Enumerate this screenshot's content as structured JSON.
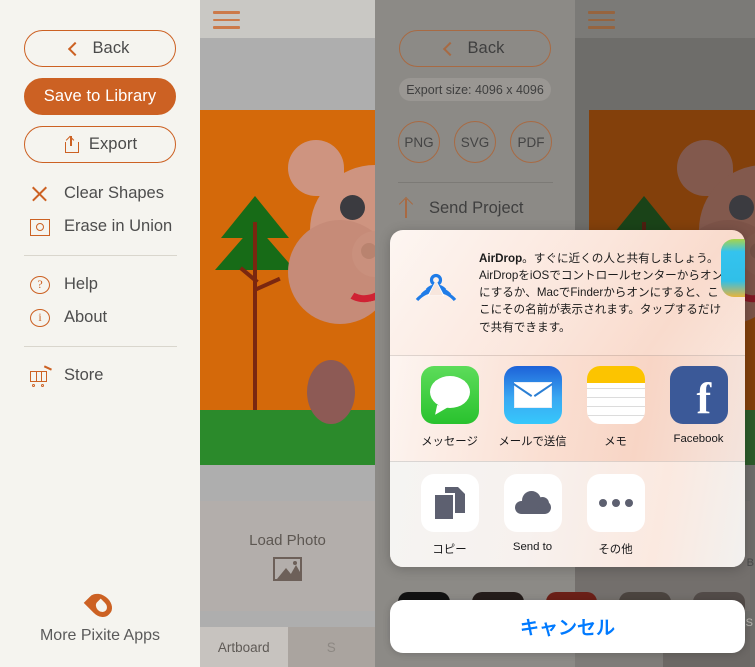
{
  "menu": {
    "back_label": "Back",
    "save_label": "Save to Library",
    "export_label": "Export",
    "items": [
      {
        "label": "Clear Shapes",
        "icon": "x-icon"
      },
      {
        "label": "Erase in Union",
        "icon": "square-circle-icon"
      },
      {
        "label": "Help",
        "icon": "question-circle-icon"
      },
      {
        "label": "About",
        "icon": "info-circle-icon"
      },
      {
        "label": "Store",
        "icon": "cart-icon"
      }
    ],
    "footer_label": "More Pixite Apps"
  },
  "artboard": {
    "load_photo_label": "Load Photo",
    "tab_artboard": "Artboard",
    "tab_second": "S"
  },
  "export": {
    "back_label": "Back",
    "size_chip": "Export size: 4096 x 4096",
    "formats": [
      "PNG",
      "SVG",
      "PDF"
    ],
    "send_project_label": "Send Project"
  },
  "share_sheet": {
    "airdrop_title": "AirDrop",
    "airdrop_text": "。すぐに近くの人と共有しましょう。AirDropをiOSでコントロールセンターからオンにするか、MacでFinderからオンにすると、ここにその名前が表示されます。タップするだけで共有できます。",
    "apps": [
      {
        "name": "メッセージ",
        "icon": "messages-icon"
      },
      {
        "name": "メールで送信",
        "icon": "mail-icon"
      },
      {
        "name": "メモ",
        "icon": "notes-icon"
      },
      {
        "name": "Facebook",
        "icon": "facebook-icon"
      }
    ],
    "actions": [
      {
        "name": "コピー",
        "icon": "copy-icon"
      },
      {
        "name": "Send to",
        "icon": "cloud-icon"
      },
      {
        "name": "その他",
        "icon": "more-dots-icon"
      }
    ],
    "cancel_label": "キャンセル"
  },
  "edges": {
    "right_b": "B",
    "right_s": "S"
  },
  "colors": {
    "accent_orange": "#cc6123",
    "canvas_orange": "#d4690a",
    "grass_green": "#2b8a2b",
    "pig_pink": "#ce9480",
    "cancel_blue": "#007aff",
    "airdrop_blue": "#1f7ce8"
  }
}
